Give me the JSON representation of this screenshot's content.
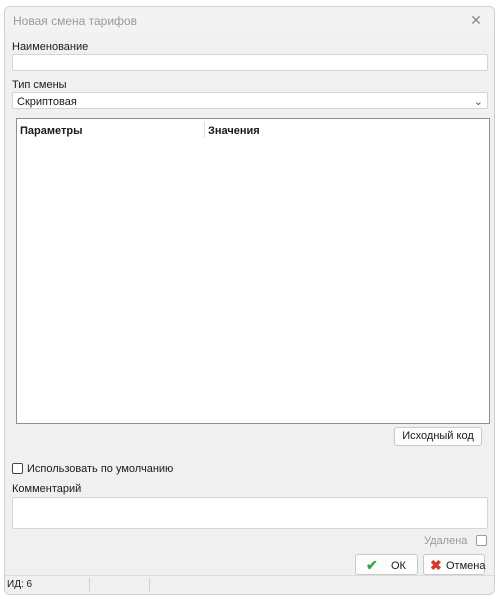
{
  "window": {
    "title": "Новая смена тарифов"
  },
  "fields": {
    "name_label": "Наименование",
    "name_value": "",
    "type_label": "Тип смены",
    "type_value": "Скриптовая"
  },
  "grid": {
    "columns": [
      "Параметры",
      "Значения"
    ],
    "rows": []
  },
  "buttons": {
    "source_code": "Исходный код",
    "ok": "ОК",
    "cancel": "Отмена"
  },
  "options": {
    "use_default_label": "Использовать по умолчанию",
    "use_default_checked": false,
    "deleted_label": "Удалена",
    "deleted_checked": false
  },
  "comment": {
    "label": "Комментарий",
    "value": ""
  },
  "status": {
    "id_text": "ИД: 6"
  },
  "colors": {
    "ok_check": "#3aa84a",
    "cancel_x": "#d23a2a"
  }
}
